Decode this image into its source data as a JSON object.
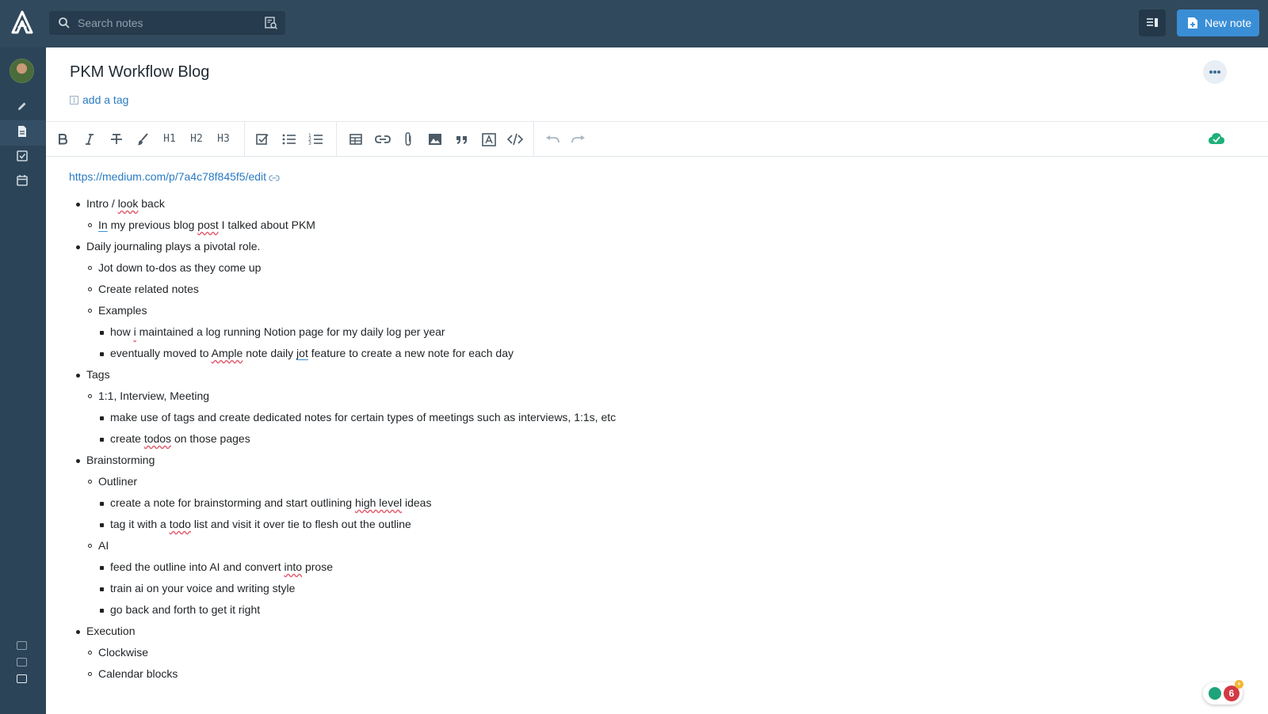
{
  "header": {
    "search_placeholder": "Search notes",
    "new_note_label": "New note"
  },
  "note": {
    "title": "PKM Workflow Blog",
    "add_tag_label": "add a tag",
    "link": "https://medium.com/p/7a4c78f845f5/edit"
  },
  "toolbar": {
    "h1": "H1",
    "h2": "H2",
    "h3": "H3"
  },
  "outline": [
    {
      "level": 1,
      "text": "Intro / look back"
    },
    {
      "level": 2,
      "text": "In my previous blog post I talked about PKM"
    },
    {
      "level": 1,
      "text": "Daily journaling plays a pivotal role."
    },
    {
      "level": 2,
      "text": "Jot down to-dos as they come up"
    },
    {
      "level": 2,
      "text": "Create related notes"
    },
    {
      "level": 2,
      "text": "Examples"
    },
    {
      "level": 3,
      "text": "how i maintained a log running Notion page for my daily log per year"
    },
    {
      "level": 3,
      "text": "eventually moved to Ample note daily jot feature to create a new note for each day"
    },
    {
      "level": 1,
      "text": "Tags"
    },
    {
      "level": 2,
      "text": "1:1, Interview, Meeting"
    },
    {
      "level": 3,
      "text": "make use of tags and create dedicated notes for certain types of meetings such as interviews, 1:1s, etc"
    },
    {
      "level": 3,
      "text": "create todos on those pages"
    },
    {
      "level": 1,
      "text": "Brainstorming"
    },
    {
      "level": 2,
      "text": "Outliner"
    },
    {
      "level": 3,
      "text": "create a note for brainstorming and start outlining high level ideas"
    },
    {
      "level": 3,
      "text": "tag it with a todo list and visit it over tie to flesh out the outline"
    },
    {
      "level": 2,
      "text": "AI"
    },
    {
      "level": 3,
      "text": "feed the outline into AI and convert into prose"
    },
    {
      "level": 3,
      "text": "train ai on your voice and writing style"
    },
    {
      "level": 3,
      "text": "go back and forth to get it right"
    },
    {
      "level": 1,
      "text": "Execution"
    },
    {
      "level": 2,
      "text": "Clockwise"
    },
    {
      "level": 2,
      "text": "Calendar blocks"
    }
  ],
  "help_widget": {
    "badge_count": "6",
    "badge_plus": "+"
  }
}
